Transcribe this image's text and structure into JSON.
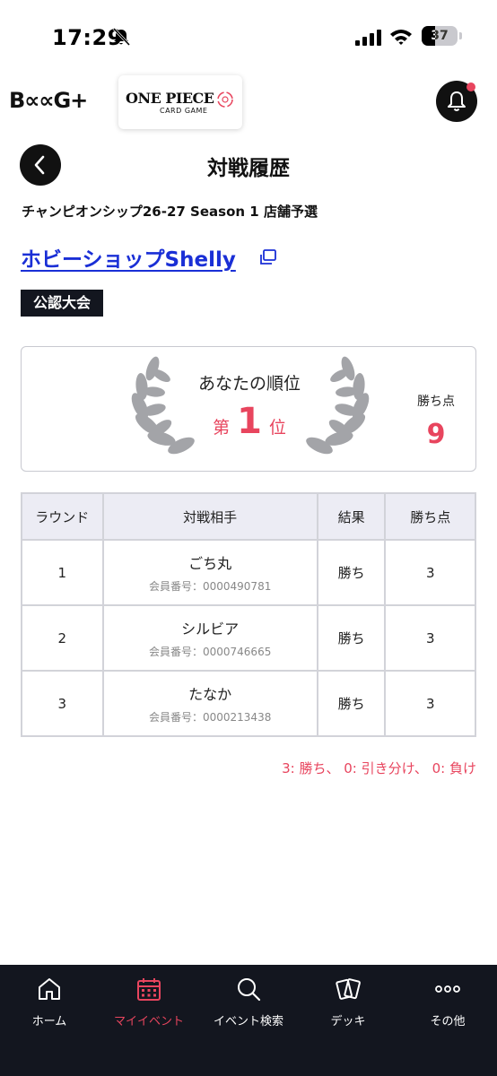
{
  "status_bar": {
    "time": "17:29",
    "battery": "37",
    "battery_level": 0.37
  },
  "header": {
    "brand": "B∝∝G+",
    "game_logo_title": "ONE PIECE",
    "game_logo_sub": "CARD GAME"
  },
  "page": {
    "title": "対戦履歴",
    "event_name": "チャンピオンシップ26-27 Season 1 店舗予選",
    "shop_name": "ホビーショップShelly",
    "badge": "公認大会"
  },
  "rank": {
    "label": "あなたの順位",
    "prefix": "第",
    "number": "1",
    "suffix": "位",
    "points_label": "勝ち点",
    "points_value": "9"
  },
  "table": {
    "headers": [
      "ラウンド",
      "対戦相手",
      "結果",
      "勝ち点"
    ],
    "member_label": "会員番号：",
    "rows": [
      {
        "round": "1",
        "opponent": "ごち丸",
        "member_id": "0000490781",
        "result": "勝ち",
        "points": "3"
      },
      {
        "round": "2",
        "opponent": "シルビア",
        "member_id": "0000746665",
        "result": "勝ち",
        "points": "3"
      },
      {
        "round": "3",
        "opponent": "たなか",
        "member_id": "0000213438",
        "result": "勝ち",
        "points": "3"
      }
    ]
  },
  "score_note": "3: 勝ち、 0: 引き分け、 0: 負け",
  "nav": {
    "items": [
      {
        "label": "ホーム",
        "icon": "home-icon",
        "active": false
      },
      {
        "label": "マイイベント",
        "icon": "calendar-icon",
        "active": true
      },
      {
        "label": "イベント検索",
        "icon": "search-icon",
        "active": false
      },
      {
        "label": "デッキ",
        "icon": "cards-icon",
        "active": false
      },
      {
        "label": "その他",
        "icon": "more-icon",
        "active": false
      }
    ]
  },
  "colors": {
    "accent": "#e8455e",
    "dark": "#13161f",
    "link": "#1a2fd6"
  }
}
